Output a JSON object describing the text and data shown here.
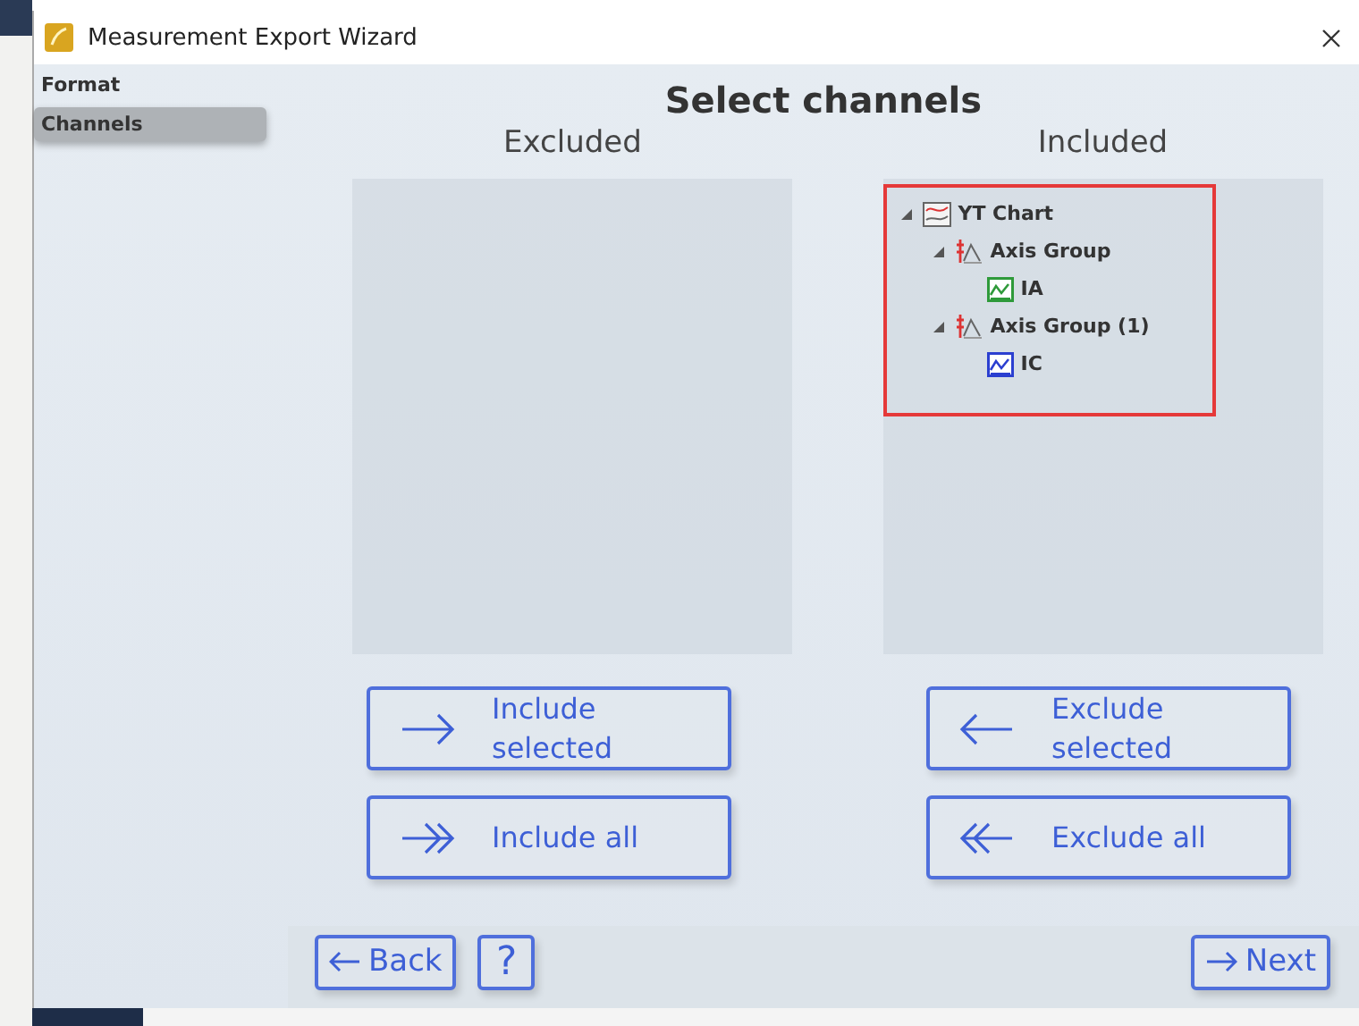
{
  "window": {
    "title": "Measurement Export Wizard"
  },
  "sidebar": {
    "items": [
      {
        "label": "Format",
        "selected": false
      },
      {
        "label": "Channels",
        "selected": true
      }
    ]
  },
  "heading": "Select channels",
  "excluded": {
    "label": "Excluded"
  },
  "included": {
    "label": "Included",
    "highlighted": true,
    "items": [
      {
        "label": "YT Chart",
        "kind": "chart",
        "expanded": true,
        "children": [
          {
            "label": "Axis Group",
            "kind": "axis",
            "expanded": true,
            "children": [
              {
                "label": "IA",
                "kind": "signal",
                "color": "#2e9a3a"
              }
            ]
          },
          {
            "label": "Axis Group (1)",
            "kind": "axis",
            "expanded": true,
            "children": [
              {
                "label": "IC",
                "kind": "signal",
                "color": "#2b3fd0"
              }
            ]
          }
        ]
      }
    ]
  },
  "actions": [
    {
      "label": "Include selected",
      "kind": "right"
    },
    {
      "label": "Exclude selected",
      "kind": "left"
    },
    {
      "label": "Include all",
      "kind": "right-all"
    },
    {
      "label": "Exclude all",
      "kind": "left-all"
    }
  ],
  "footer": {
    "back": "Back",
    "help": "?",
    "next": "Next"
  }
}
